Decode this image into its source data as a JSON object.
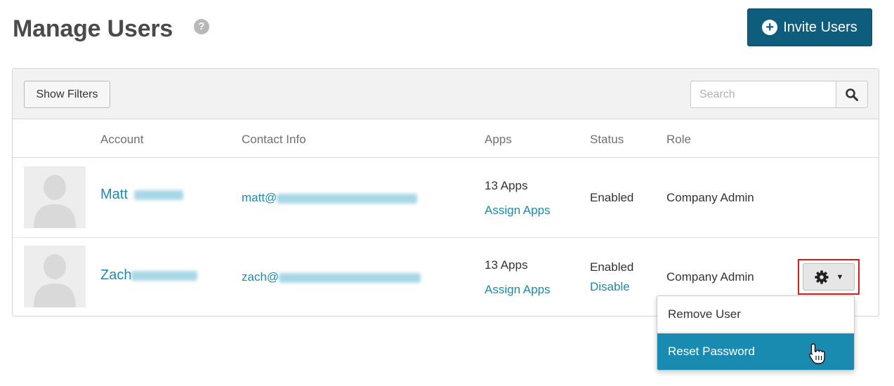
{
  "header": {
    "title": "Manage Users",
    "help_icon": "question-circle-icon",
    "invite_label": "Invite Users",
    "invite_icon": "plus-circle-icon"
  },
  "colors": {
    "primary": "#0e5d7c",
    "link": "#1a8bb0",
    "highlight_border": "#e01818",
    "menu_active": "#1a8bb0"
  },
  "toolbar": {
    "filters_label": "Show Filters",
    "search_placeholder": "Search",
    "search_value": "",
    "search_icon": "magnifier-icon"
  },
  "table": {
    "columns": [
      "Account",
      "Contact Info",
      "Apps",
      "Status",
      "Role"
    ],
    "rows": [
      {
        "name_visible": "Matt",
        "email_visible": "matt@",
        "apps": "13 Apps",
        "apps_action": "Assign Apps",
        "status": "Enabled",
        "status_action": "",
        "role": "Company Admin"
      },
      {
        "name_visible": "Zach",
        "email_visible": "zach@",
        "apps": "13 Apps",
        "apps_action": "Assign Apps",
        "status": "Enabled",
        "status_action": "Disable",
        "role": "Company Admin"
      }
    ]
  },
  "row_menu": {
    "trigger_icon": "gear-icon",
    "items": [
      "Remove User",
      "Reset Password"
    ],
    "active_index": 1
  }
}
